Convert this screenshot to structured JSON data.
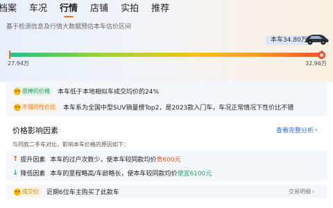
{
  "tabs": [
    {
      "label": "档案"
    },
    {
      "label": "车况"
    },
    {
      "label": "行情"
    },
    {
      "label": "店铺"
    },
    {
      "label": "实拍"
    },
    {
      "label": "推荐"
    }
  ],
  "price_range": {
    "subtitle": "基于检测信息及行情大数据预估本车估价区间",
    "current_price_label": "本车34.80万",
    "low": "27.94万",
    "high": "32.96万",
    "position_fraction": 1.0
  },
  "highlights": [
    {
      "tag": "很棒的价格",
      "text": "本车低于本地相似车成交均价的24%"
    },
    {
      "tag": "不错的性价比",
      "text": "本车系为全国中型SUV销量榜Top2，是2023款入门车，车况正常情况下性价比不错"
    }
  ],
  "factors": {
    "title": "价格影响因素",
    "full_link": "查看完整分析",
    "description": "与同款二手车对比，影响本车价格的原因如下：",
    "items": [
      {
        "type": "提升因素",
        "direction": "up",
        "text": "本车的过户次数少，使本车较同款均价",
        "highlight": "贵600元"
      },
      {
        "type": "降低因素",
        "direction": "down",
        "text": "本车的里程略高/车龄略长，使本车较同款均价",
        "highlight": "便宜6100元"
      }
    ]
  },
  "deal": {
    "tag": "成交价",
    "text": "近期6位车主购买了此款车",
    "link": "交易明细"
  },
  "colors": {
    "accent": "#ff6a1a",
    "link": "#2f6fd6",
    "up": "#e8541c",
    "down": "#1aa86a"
  }
}
